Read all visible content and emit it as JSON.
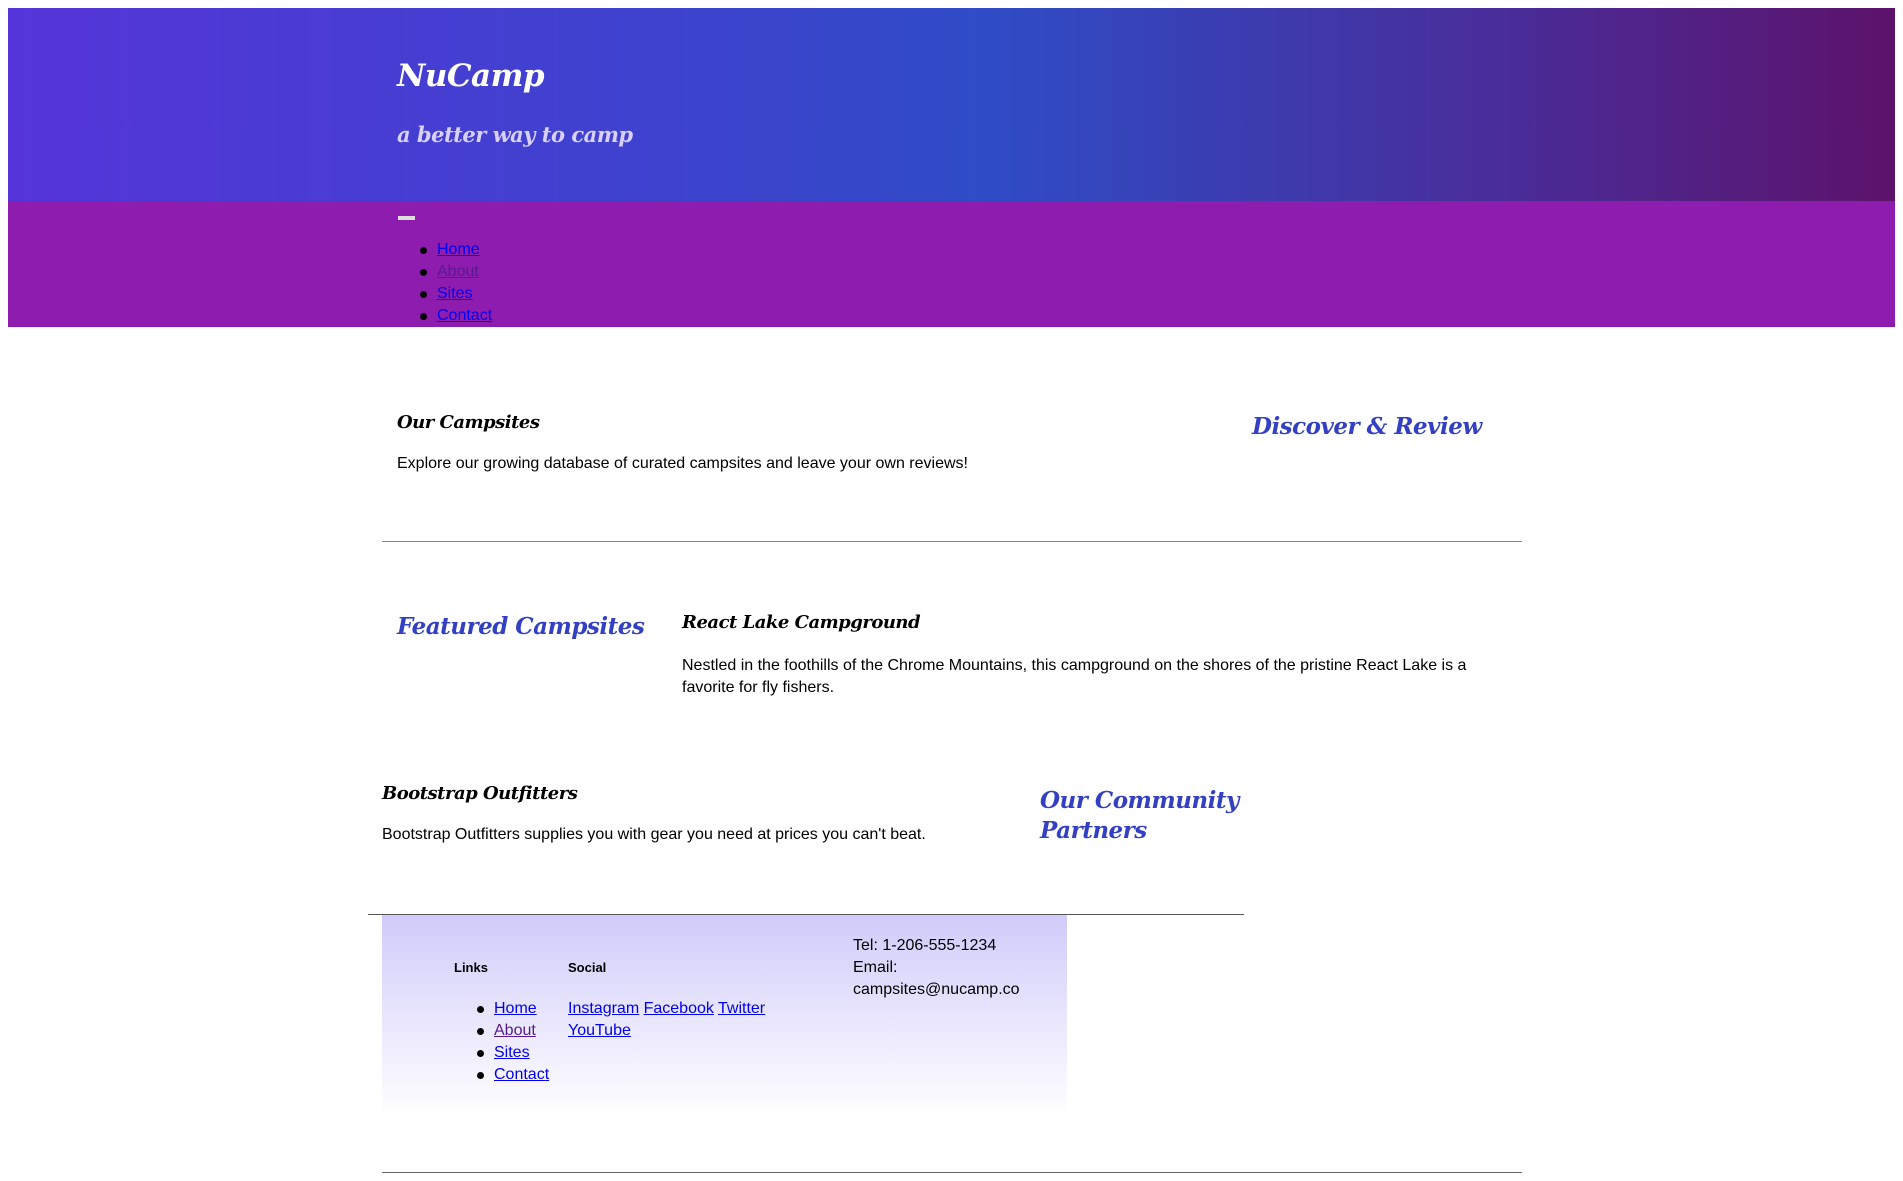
{
  "header": {
    "brand": "NuCamp",
    "tagline": "a better way to camp",
    "background_colors": [
      "#5535d9",
      "#2f4cc6",
      "#5c136b"
    ]
  },
  "navbar": {
    "background": "#8d1caf",
    "toggler_icon": "menu-toggle-icon",
    "items": [
      {
        "label": "Home"
      },
      {
        "label": "About"
      },
      {
        "label": "Sites"
      },
      {
        "label": "Contact"
      }
    ]
  },
  "campsites": {
    "heading": "Our Campsites",
    "text": "Explore our growing database of curated campsites and leave your own reviews!",
    "side_heading": "Discover & Review"
  },
  "featured": {
    "side_heading": "Featured Campsites",
    "title": "React Lake Campground",
    "text": "Nestled in the foothills of the Chrome Mountains, this campground on the shores of the pristine React Lake is a favorite for fly fishers."
  },
  "partners": {
    "title": "Bootstrap Outfitters",
    "text": "Bootstrap Outfitters supplies you with gear you need at prices you can't beat.",
    "side_heading": "Our Community Partners"
  },
  "footer": {
    "links_heading": "Links",
    "links": [
      {
        "label": "Home"
      },
      {
        "label": "About"
      },
      {
        "label": "Sites"
      },
      {
        "label": "Contact"
      }
    ],
    "social_heading": "Social",
    "social": [
      {
        "label": "Instagram"
      },
      {
        "label": "Facebook"
      },
      {
        "label": "Twitter"
      },
      {
        "label": "YouTube"
      }
    ],
    "tel": "Tel: 1-206-555-1234",
    "email_label": "Email:",
    "email": "campsites@nucamp.co"
  },
  "colors": {
    "accent_heading": "#3340c4",
    "footer_gradient_top": "#d0cbfa"
  }
}
